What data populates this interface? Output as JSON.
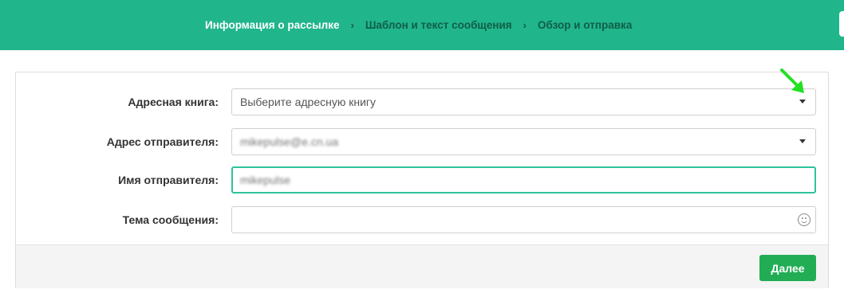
{
  "steps": [
    {
      "label": "Информация о рассылке",
      "active": true
    },
    {
      "label": "Шаблон и текст сообщения",
      "active": false
    },
    {
      "label": "Обзор и отправка",
      "active": false
    }
  ],
  "separator": "›",
  "form": {
    "address_book": {
      "label": "Адресная книга:",
      "placeholder": "Выберите адресную книгу"
    },
    "sender_address": {
      "label": "Адрес отправителя:",
      "value": "mikepulse@e.cn.ua"
    },
    "sender_name": {
      "label": "Имя отправителя:",
      "value": "mikepulse"
    },
    "subject": {
      "label": "Тема сообщения:",
      "value": ""
    }
  },
  "footer": {
    "next_label": "Далее"
  },
  "colors": {
    "header_bg": "#21b58c",
    "next_button": "#22ad55",
    "focus_border": "#2ec39a",
    "annotation_arrow": "#22e022"
  },
  "icons": {
    "step_separator": "chevron-right-icon",
    "dropdown": "caret-down-icon",
    "emoji": "smiley-icon",
    "annotation": "green-arrow-icon"
  }
}
